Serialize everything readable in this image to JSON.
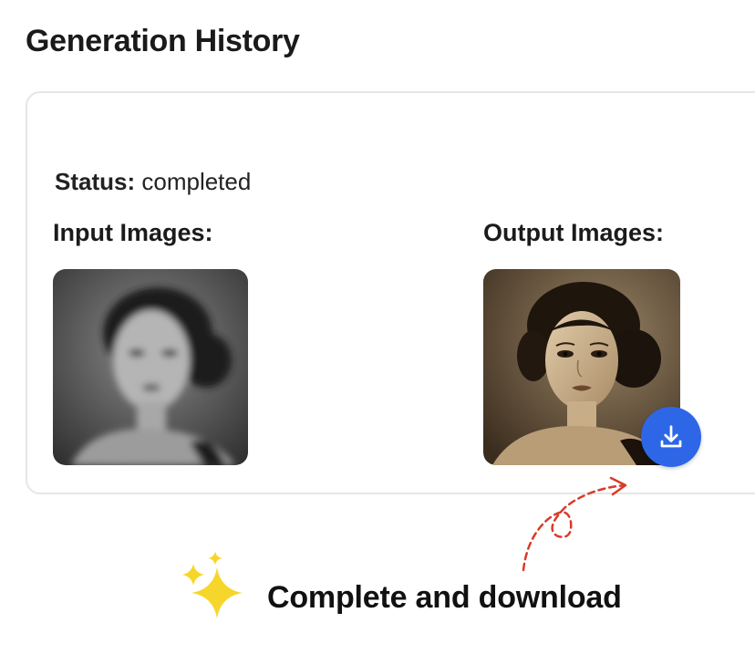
{
  "header": {
    "title": "Generation History"
  },
  "card": {
    "status_label": "Status:",
    "status_value": "completed",
    "input_label": "Input Images:",
    "output_label": "Output Images:"
  },
  "annotation": {
    "caption": "Complete and download"
  },
  "icons": {
    "download": "download-icon",
    "sparkle": "sparkle-icon"
  },
  "colors": {
    "download_button": "#2d67e8",
    "arrow": "#d93a2b",
    "sparkle": "#f7d62b"
  }
}
